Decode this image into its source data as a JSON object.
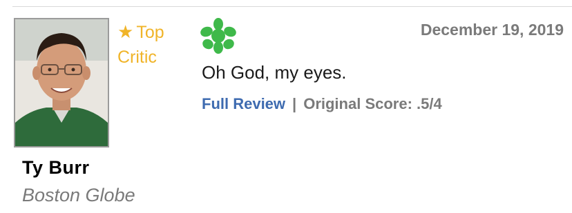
{
  "critic": {
    "name": "Ty Burr",
    "publication": "Boston Globe",
    "badge_label": "Top\nCritic",
    "badge_color": "#f0b429"
  },
  "review": {
    "score_icon": "rotten-splat-icon",
    "score_color": "#3fb94a",
    "date": "December 19, 2019",
    "quote": "Oh God, my eyes.",
    "full_review_label": "Full Review",
    "separator": "|",
    "original_score_label": "Original Score: .5/4",
    "link_color": "#3e6bb0"
  }
}
